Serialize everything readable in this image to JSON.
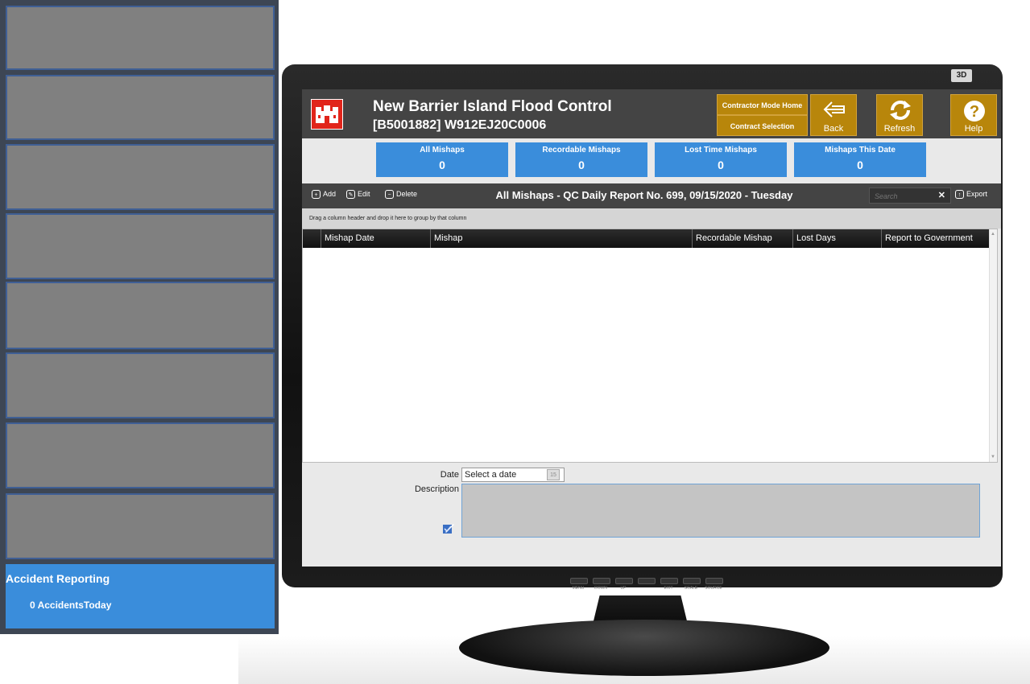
{
  "tiles": {
    "accident": {
      "title": "Accident Reporting",
      "subtitle": "0 AccidentsToday"
    }
  },
  "monitor": {
    "badge": "3D",
    "buttons": [
      "MENU",
      "DOWN",
      "UP",
      "",
      "EXIT",
      "SCALE",
      "SOURCE"
    ]
  },
  "header": {
    "project_name": "New Barrier Island Flood Control",
    "project_id": "[B5001882] W912EJ20C0006",
    "contractor_home": "Contractor Mode Home",
    "contract_selection": "Contract Selection",
    "back": "Back",
    "refresh": "Refresh",
    "help": "Help"
  },
  "stats": [
    {
      "label": "All Mishaps",
      "value": "0"
    },
    {
      "label": "Recordable Mishaps",
      "value": "0"
    },
    {
      "label": "Lost Time Mishaps",
      "value": "0"
    },
    {
      "label": "Mishaps This Date",
      "value": "0"
    }
  ],
  "toolbar": {
    "add": "Add",
    "edit": "Edit",
    "delete": "Delete",
    "title": "All Mishaps - QC Daily Report No. 699, 09/15/2020 - Tuesday",
    "search_placeholder": "Search",
    "export": "Export"
  },
  "grid": {
    "group_hint": "Drag a column header and drop it here to group by that column",
    "columns": [
      "Mishap Date",
      "Mishap",
      "Recordable Mishap",
      "Lost Days",
      "Report to Government"
    ],
    "rows": []
  },
  "detail": {
    "date_label": "Date",
    "date_placeholder": "Select a date",
    "calendar_day": "15",
    "description_label": "Description"
  },
  "colors": {
    "accent_blue": "#3a8ddb",
    "gold": "#b8860b",
    "header_dark": "#444444",
    "logo_red": "#e1251b"
  }
}
